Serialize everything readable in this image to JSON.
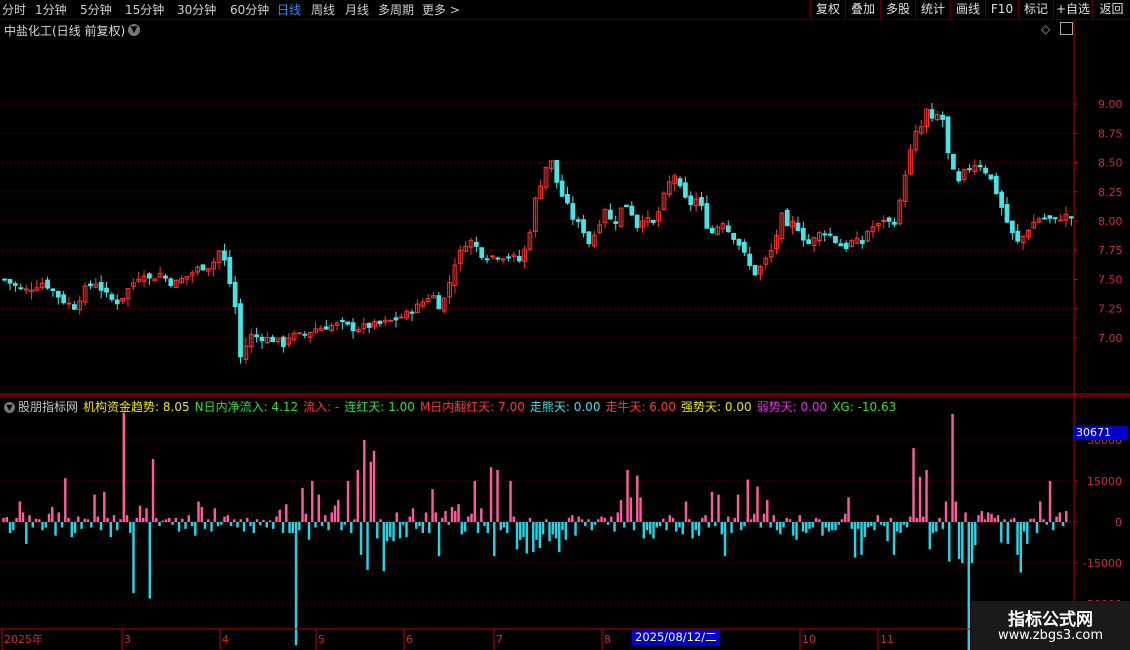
{
  "toolbar": {
    "periods": [
      "分时",
      "1分钟",
      "5分钟",
      "15分钟",
      "30分钟",
      "60分钟",
      "日线",
      "周线",
      "月线",
      "多周期",
      "更多 >"
    ],
    "active_period": "日线",
    "actions": [
      "复权",
      "叠加",
      "多股",
      "统计",
      "画线",
      "F10",
      "标记",
      "+自选",
      "返回"
    ]
  },
  "title": "中盐化工(日线 前复权)",
  "legend": [
    {
      "text": "股朋指标网",
      "color": "#c8c8c8"
    },
    {
      "text": "机构资金趋势: 8.05",
      "color": "#e8e800"
    },
    {
      "text": "N日内净流入: 4.12",
      "color": "#33dd33"
    },
    {
      "text": "流入: -",
      "color": "#ff3333"
    },
    {
      "text": "连红天: 1.00",
      "color": "#33dd33"
    },
    {
      "text": "M日内翻红天: 7.00",
      "color": "#ff3333"
    },
    {
      "text": "走熊天: 0.00",
      "color": "#44dddd"
    },
    {
      "text": "走牛天: 6.00",
      "color": "#ff3333"
    },
    {
      "text": "强势天: 0.00",
      "color": "#e8e800"
    },
    {
      "text": "弱势天: 0.00",
      "color": "#dd33dd"
    },
    {
      "text": "XG: -10.63",
      "color": "#33dd33"
    }
  ],
  "vol_badge": "30671",
  "date_badge": "2025/08/12/二",
  "watermark": {
    "title": "指标公式网",
    "url": "www.zbgs3.com"
  },
  "colors": {
    "up": "#ff3030",
    "down": "#44e5e5",
    "hist_pos": "#ff5a9a",
    "hist_neg": "#22d5e5",
    "axis": "#c00000",
    "grid": "#6a0000"
  },
  "chart_data": [
    {
      "type": "candlestick",
      "title": "中盐化工(日线 前复权)",
      "y_ticks": [
        7.0,
        7.25,
        7.5,
        7.75,
        8.0,
        8.25,
        8.5,
        8.75,
        9.0
      ],
      "ylim": [
        6.52,
        9.72
      ],
      "x_labels": [
        "2025年",
        "3",
        "4",
        "5",
        "6",
        "7",
        "8",
        "10",
        "11"
      ],
      "close_path": [
        [
          0,
          7.5
        ],
        [
          15,
          7.4
        ],
        [
          30,
          7.48
        ],
        [
          45,
          7.32
        ],
        [
          55,
          7.26
        ],
        [
          60,
          7.4
        ],
        [
          70,
          7.48
        ],
        [
          80,
          7.35
        ],
        [
          86,
          7.3
        ],
        [
          92,
          7.36
        ],
        [
          96,
          7.43
        ],
        [
          103,
          7.52
        ],
        [
          108,
          7.56
        ],
        [
          112,
          7.5
        ],
        [
          120,
          7.55
        ],
        [
          130,
          7.46
        ],
        [
          140,
          7.52
        ],
        [
          150,
          7.6
        ],
        [
          160,
          7.62
        ],
        [
          166,
          7.75
        ],
        [
          170,
          7.65
        ],
        [
          173,
          7.55
        ],
        [
          176,
          7.28
        ],
        [
          178,
          7.28
        ],
        [
          180,
          6.78
        ],
        [
          184,
          6.88
        ],
        [
          190,
          7.02
        ],
        [
          200,
          7.0
        ],
        [
          210,
          6.98
        ],
        [
          215,
          6.94
        ],
        [
          220,
          7.02
        ],
        [
          230,
          7.02
        ],
        [
          240,
          7.08
        ],
        [
          250,
          7.1
        ],
        [
          260,
          7.12
        ],
        [
          270,
          7.08
        ],
        [
          280,
          7.1
        ],
        [
          290,
          7.12
        ],
        [
          300,
          7.15
        ],
        [
          310,
          7.2
        ],
        [
          320,
          7.28
        ],
        [
          330,
          7.38
        ],
        [
          337,
          7.25
        ],
        [
          343,
          7.45
        ],
        [
          348,
          7.65
        ],
        [
          353,
          7.75
        ],
        [
          358,
          7.85
        ],
        [
          363,
          7.8
        ],
        [
          368,
          7.72
        ],
        [
          373,
          7.7
        ],
        [
          380,
          7.7
        ],
        [
          387,
          7.7
        ],
        [
          392,
          7.7
        ],
        [
          397,
          7.65
        ],
        [
          402,
          7.76
        ],
        [
          408,
          8.02
        ],
        [
          412,
          8.35
        ],
        [
          416,
          8.3
        ],
        [
          420,
          8.6
        ],
        [
          426,
          8.35
        ],
        [
          430,
          8.23
        ],
        [
          436,
          8.1
        ],
        [
          440,
          8.0
        ],
        [
          446,
          7.95
        ],
        [
          452,
          7.8
        ],
        [
          458,
          7.95
        ],
        [
          464,
          8.12
        ],
        [
          470,
          7.95
        ],
        [
          476,
          8.1
        ],
        [
          482,
          8.15
        ],
        [
          488,
          7.95
        ],
        [
          494,
          8.05
        ],
        [
          500,
          7.95
        ],
        [
          506,
          8.1
        ],
        [
          512,
          8.3
        ],
        [
          518,
          8.4
        ],
        [
          524,
          8.2
        ],
        [
          530,
          8.15
        ],
        [
          536,
          8.2
        ],
        [
          540,
          8.05
        ],
        [
          545,
          7.88
        ],
        [
          550,
          7.95
        ],
        [
          555,
          8.0
        ],
        [
          560,
          7.9
        ],
        [
          565,
          7.85
        ],
        [
          570,
          7.75
        ],
        [
          575,
          7.62
        ],
        [
          580,
          7.55
        ],
        [
          585,
          7.62
        ],
        [
          590,
          7.7
        ],
        [
          594,
          7.78
        ],
        [
          600,
          8.05
        ],
        [
          605,
          7.92
        ],
        [
          610,
          8.0
        ],
        [
          615,
          7.9
        ],
        [
          620,
          7.8
        ],
        [
          626,
          7.85
        ],
        [
          632,
          7.92
        ],
        [
          638,
          7.88
        ],
        [
          644,
          7.8
        ],
        [
          650,
          7.78
        ],
        [
          656,
          7.84
        ],
        [
          662,
          7.8
        ],
        [
          668,
          7.95
        ],
        [
          674,
          7.95
        ],
        [
          680,
          8.03
        ],
        [
          686,
          7.95
        ],
        [
          690,
          8.1
        ],
        [
          694,
          8.25
        ],
        [
          696,
          8.45
        ],
        [
          700,
          8.6
        ],
        [
          704,
          8.75
        ],
        [
          708,
          8.8
        ],
        [
          712,
          8.95
        ],
        [
          716,
          8.85
        ],
        [
          720,
          8.9
        ],
        [
          724,
          8.92
        ],
        [
          728,
          8.6
        ],
        [
          732,
          8.45
        ],
        [
          736,
          8.3
        ],
        [
          740,
          8.4
        ],
        [
          744,
          8.45
        ],
        [
          748,
          8.48
        ],
        [
          752,
          8.5
        ],
        [
          756,
          8.45
        ],
        [
          760,
          8.4
        ],
        [
          764,
          8.3
        ],
        [
          768,
          8.2
        ],
        [
          772,
          8.05
        ],
        [
          776,
          7.95
        ],
        [
          780,
          7.85
        ],
        [
          784,
          7.8
        ],
        [
          788,
          7.9
        ],
        [
          792,
          7.95
        ],
        [
          796,
          8.0
        ],
        [
          800,
          8.03
        ],
        [
          806,
          8.02
        ],
        [
          812,
          8.0
        ],
        [
          818,
          8.05
        ],
        [
          824,
          8.03
        ]
      ]
    },
    {
      "type": "bar",
      "title": "股朋指标网",
      "y_ticks": [
        30000,
        15000,
        0,
        -15000,
        -30000
      ],
      "ylim": [
        -38000,
        38000
      ],
      "values": [
        1500,
        1800,
        -4000,
        -3000,
        1500,
        7500,
        3500,
        -8000,
        2500,
        -2000,
        1200,
        1000,
        -3000,
        -2000,
        3000,
        5500,
        -5000,
        3500,
        -2000,
        16000,
        1500,
        -5500,
        -4000,
        2000,
        -2500,
        1200,
        1000,
        -2000,
        10000,
        2000,
        -3000,
        11000,
        1500,
        -5500,
        2500,
        -3000,
        1000,
        40000,
        2500,
        -4000,
        -26000,
        1500,
        6000,
        1500,
        5000,
        -28000,
        23000,
        1500,
        -1500,
        500,
        1000,
        1500,
        -1000,
        1500,
        -3500,
        1200,
        -2500,
        2500,
        -1500,
        -5000,
        7500,
        5500,
        -2500,
        1000,
        -3500,
        5000,
        -1500,
        -1000,
        2000,
        2500,
        -1500,
        1000,
        -2000,
        1000,
        -3500,
        1500,
        -1500,
        -4000,
        1000,
        -1200,
        800,
        -2000,
        600,
        -2500,
        2000,
        4500,
        -4000,
        6500,
        -4000,
        -4000,
        -45000,
        -3000,
        12500,
        3000,
        -6500,
        15000,
        -2000,
        10000,
        -1500,
        2500,
        -3000,
        3500,
        6000,
        8000,
        -3000,
        -1000,
        15000,
        -4000,
        1000,
        19000,
        -12000,
        30000,
        -17500,
        22000,
        26000,
        -6000,
        1000,
        -18000,
        -7000,
        -5500,
        -7000,
        3500,
        -6000,
        -1000,
        -5500,
        2000,
        5000,
        -2500,
        -1500,
        -4000,
        3500,
        -4000,
        12000,
        3500,
        -12500,
        1500,
        4000,
        -1000,
        5500,
        4000,
        6500,
        -4500,
        -3500,
        2000,
        3000,
        15000,
        -4000,
        5000,
        -1500,
        -4000,
        20000,
        -12500,
        19000,
        -3000,
        -2000,
        -4000,
        15000,
        2000,
        -10000,
        -6500,
        -5500,
        -11500,
        1500,
        -11000,
        -6500,
        -9500,
        -4500,
        1000,
        -7000,
        -4500,
        -6000,
        -11000,
        -3000,
        -6500,
        1500,
        2500,
        -5000,
        2000,
        1000,
        -1500,
        1000,
        -3000,
        -1000,
        1000,
        2000,
        1500,
        -1000,
        2000,
        -3500,
        3500,
        8000,
        -2000,
        19000,
        9000,
        -3000,
        17000,
        9000,
        -6000,
        -3000,
        -4500,
        -6000,
        -2000,
        -1500,
        1200,
        -3000,
        2500,
        1500,
        -3500,
        -2000,
        -4500,
        7500,
        1000,
        -6000,
        -3000,
        -5000,
        1500,
        2500,
        -2000,
        11000,
        -1500,
        10000,
        -4500,
        -12500,
        2000,
        -4000,
        1500,
        10000,
        -3000,
        -1500,
        15500,
        1000,
        3000,
        13000,
        -2000,
        3000,
        8000,
        -2000,
        2500,
        -3000,
        -4500,
        -2000,
        1500,
        1000,
        -5000,
        -6500,
        2500,
        -3500,
        -4000,
        -2500,
        -2000,
        1500,
        1000,
        -5000,
        -2000,
        -3500,
        -3000,
        -3000,
        -1000,
        1000,
        3000,
        9000,
        -2500,
        -13000,
        -2500,
        -12000,
        -5500,
        -2000,
        -1500,
        -3000,
        2500,
        -1000,
        -1500,
        -7000,
        1500,
        -12000,
        -3500,
        -4000,
        -1000,
        -2000,
        2000,
        27000,
        1500,
        16500,
        2000,
        19000,
        -10000,
        -4000,
        -3500,
        1500,
        -2500,
        7500,
        -14500,
        39500,
        7500,
        -13500,
        -15000,
        3500,
        -52000,
        -15000,
        -8500,
        2500,
        4000,
        1000,
        3500,
        3000,
        1500,
        2500,
        -7500,
        1000,
        -8000,
        1000,
        1500,
        -12000,
        -18500,
        -3500,
        -8000,
        1200,
        1200,
        -4000,
        7500,
        1000,
        -1000,
        15000,
        -3000,
        2000,
        3500,
        -1500,
        4000
      ]
    }
  ]
}
